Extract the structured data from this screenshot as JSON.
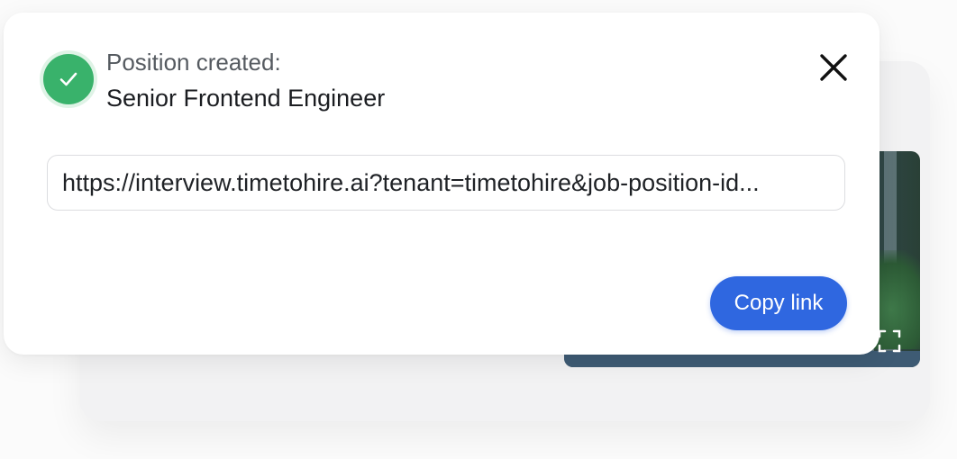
{
  "toast": {
    "status_icon": "check-circle-icon",
    "title": "Position created:",
    "position_name": "Senior Frontend Engineer",
    "close_icon": "close-icon",
    "link": "https://interview.timetohire.ai?tenant=timetohire&job-position-id...",
    "copy_button_label": "Copy link"
  },
  "background": {
    "video_controls_icon": "fullscreen-icon"
  },
  "colors": {
    "success": "#39b26b",
    "primary": "#2f67e0"
  }
}
